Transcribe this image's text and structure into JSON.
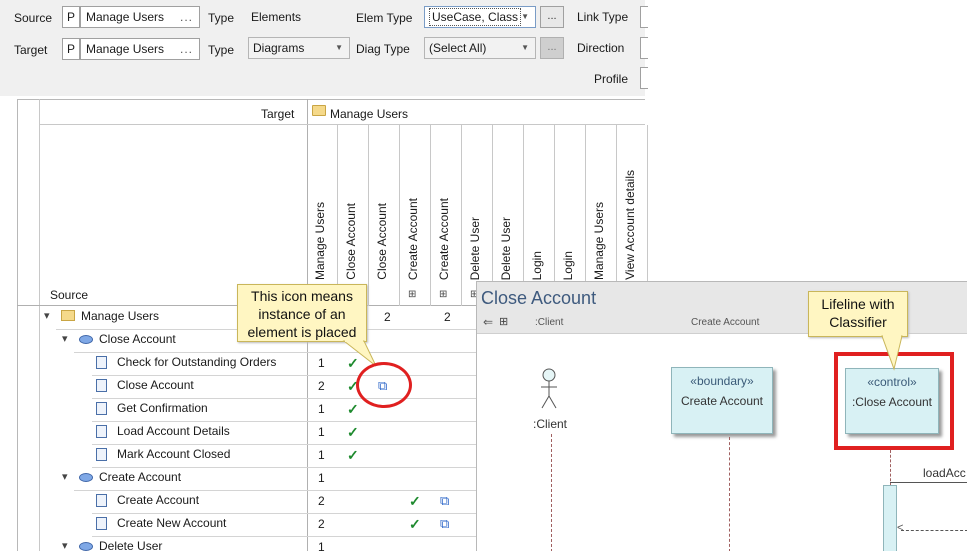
{
  "filter": {
    "source_label": "Source",
    "target_label": "Target",
    "source_package_badge": "P",
    "target_package_badge": "P",
    "source_value": "Manage Users",
    "target_value": "Manage Users",
    "ellipsis": "...",
    "type_label": "Type",
    "source_type": "Elements",
    "target_type": "Diagrams",
    "elem_type_label": "Elem Type",
    "elem_type_value": "UseCase, Class",
    "diag_type_label": "Diag Type",
    "diag_type_value": "(Select All)",
    "link_type_label": "Link Type",
    "direction_label": "Direction",
    "profile_label": "Profile"
  },
  "matrix": {
    "target_label": "Target",
    "target_package": "Manage Users",
    "source_label": "Source",
    "columns": [
      {
        "label": "Manage Users",
        "icon": ""
      },
      {
        "label": "Close Account",
        "icon": ""
      },
      {
        "label": "Close Account",
        "icon": ""
      },
      {
        "label": "Create Account",
        "icon": "sequence-diagram-icon"
      },
      {
        "label": "Create Account",
        "icon": "sequence-diagram-icon"
      },
      {
        "label": "Delete User",
        "icon": "sequence-diagram-icon"
      },
      {
        "label": "Delete User",
        "icon": ""
      },
      {
        "label": "Login",
        "icon": ""
      },
      {
        "label": "Login",
        "icon": ""
      },
      {
        "label": "Manage Users",
        "icon": ""
      },
      {
        "label": "View Account details",
        "icon": ""
      }
    ],
    "header_counts": [
      "2",
      "2"
    ],
    "rows": [
      {
        "label": "Manage Users",
        "kind": "package",
        "count": ""
      },
      {
        "label": "Close Account",
        "kind": "usecase",
        "count": ""
      },
      {
        "label": "Check for Outstanding Orders",
        "kind": "requirement",
        "count": "1"
      },
      {
        "label": "Close Account",
        "kind": "requirement",
        "count": "2"
      },
      {
        "label": "Get Confirmation",
        "kind": "requirement",
        "count": "1"
      },
      {
        "label": "Load Account Details",
        "kind": "requirement",
        "count": "1"
      },
      {
        "label": "Mark Account Closed",
        "kind": "requirement",
        "count": "1"
      },
      {
        "label": "Create Account",
        "kind": "usecase",
        "count": "1"
      },
      {
        "label": "Create Account",
        "kind": "requirement",
        "count": "2"
      },
      {
        "label": "Create New Account",
        "kind": "requirement",
        "count": "2"
      },
      {
        "label": "Delete User",
        "kind": "usecase",
        "count": "1"
      }
    ],
    "check_glyph": "✓",
    "instance_glyph": "⧉"
  },
  "diagram": {
    "title": "Close Account",
    "header_client": ":Client",
    "header_create_account": "Create Account",
    "actor_name": ":Client",
    "boundary_stereotype": "«boundary»",
    "boundary_name": "Create Account",
    "control_stereotype": "«control»",
    "control_name": ":Close Account",
    "message_label": "loadAcc"
  },
  "callouts": {
    "instance_note": "This icon means instance of an element is placed",
    "lifeline_note": "Lifeline with Classifier"
  },
  "colors": {
    "check": "#1e8a2e",
    "highlight_red": "#e02020",
    "callout_bg": "#fff6c2",
    "lifeline_fill": "#d8f1f4"
  }
}
